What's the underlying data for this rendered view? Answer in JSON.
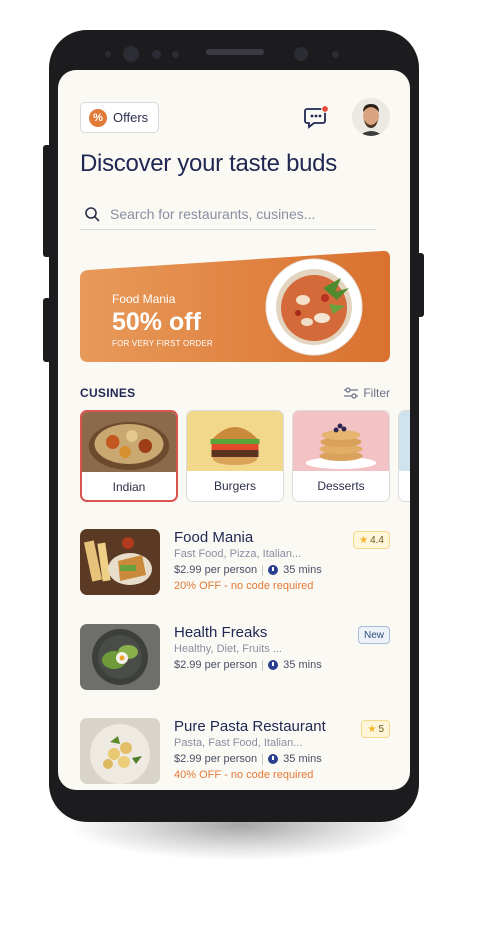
{
  "header": {
    "offers_label": "Offers",
    "offers_icon": "percent-badge-icon",
    "chat_icon": "chat-icon",
    "notification_color": "#e74c3c"
  },
  "title": "Discover your taste buds",
  "search": {
    "placeholder": "Search for restaurants, cusines..."
  },
  "banner": {
    "brand": "Food Mania",
    "discount": "50% off",
    "note": "FOR VERY FIRST ORDER",
    "accent": "#e07a37"
  },
  "cuisines": {
    "title": "CUSINES",
    "filter_label": "Filter",
    "items": [
      {
        "label": "Indian",
        "active": true
      },
      {
        "label": "Burgers",
        "active": false
      },
      {
        "label": "Desserts",
        "active": false
      }
    ]
  },
  "restaurants": [
    {
      "name": "Food Mania",
      "tags": "Fast Food, Pizza, Italian...",
      "price": "$2.99 per person",
      "time": "35 mins",
      "offer": "20% OFF - no code required",
      "badge": "4.4",
      "badge_type": "rating"
    },
    {
      "name": "Health Freaks",
      "tags": "Healthy, Diet, Fruits ...",
      "price": "$2.99 per person",
      "time": "35 mins",
      "offer": "",
      "badge": "New",
      "badge_type": "new"
    },
    {
      "name": "Pure Pasta Restaurant",
      "tags": "Pasta, Fast Food, Italian...",
      "price": "$2.99 per person",
      "time": "35 mins",
      "offer": "40% OFF - no code required",
      "badge": "5",
      "badge_type": "rating"
    }
  ]
}
